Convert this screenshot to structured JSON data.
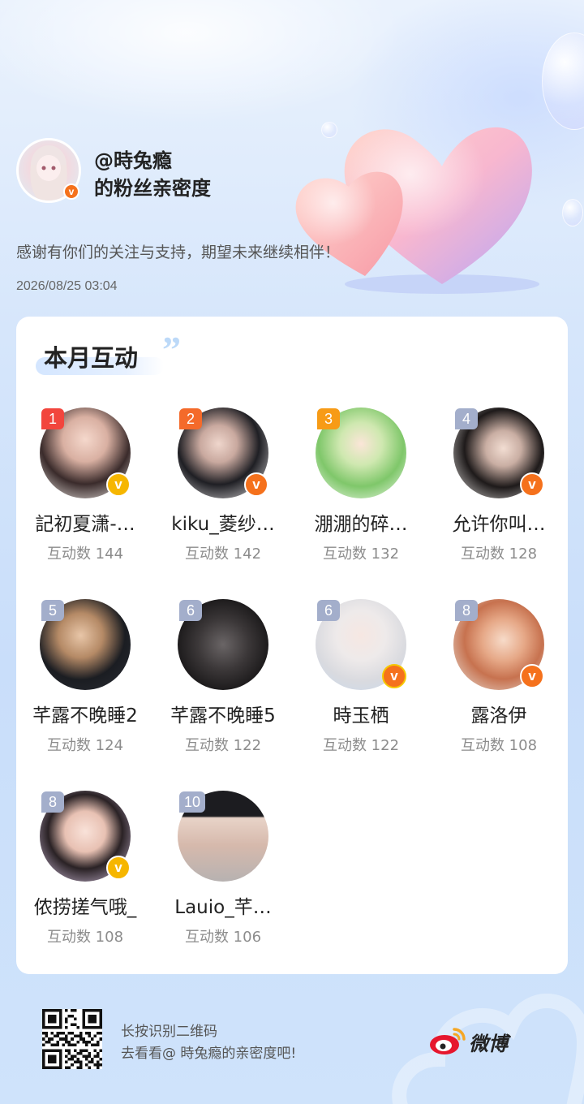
{
  "header": {
    "username": "@時兔瘾",
    "title": "的粉丝亲密度",
    "message": "感谢有你们的关注与支持，期望未来继续相伴！",
    "datetime": "2026/08/25 03:04",
    "verified": "v"
  },
  "card": {
    "title": "本月互动",
    "quote": "”",
    "fans": [
      {
        "rank": "1",
        "name": "記初夏潇-…",
        "count": "互动数 144",
        "badge": "v",
        "badge_color": "#f6b600"
      },
      {
        "rank": "2",
        "name": "kiku_菱纱…",
        "count": "互动数 142",
        "badge": "v",
        "badge_color": "#f5711c"
      },
      {
        "rank": "3",
        "name": "淜淜的碎…",
        "count": "互动数 132",
        "badge": "",
        "badge_color": ""
      },
      {
        "rank": "4",
        "name": "允许你叫…",
        "count": "互动数 128",
        "badge": "v",
        "badge_color": "#f5711c"
      },
      {
        "rank": "5",
        "name": "芊露不晚睡2",
        "count": "互动数 124",
        "badge": "",
        "badge_color": ""
      },
      {
        "rank": "6",
        "name": "芊露不晚睡5",
        "count": "互动数 122",
        "badge": "",
        "badge_color": ""
      },
      {
        "rank": "6",
        "name": "時玉栖",
        "count": "互动数 122",
        "badge": "v",
        "badge_color": "#f5711c"
      },
      {
        "rank": "8",
        "name": "露洛伊",
        "count": "互动数 108",
        "badge": "v",
        "badge_color": "#f5711c"
      },
      {
        "rank": "8",
        "name": "侬捞搓气哦_",
        "count": "互动数 108",
        "badge": "v",
        "badge_color": "#f6b600"
      },
      {
        "rank": "10",
        "name": "Lauio_芊…",
        "count": "互动数 106",
        "badge": "",
        "badge_color": ""
      }
    ]
  },
  "footer": {
    "line1": "长按识别二维码",
    "line2": "去看看@ 時兔瘾的亲密度吧!",
    "brand": "微博",
    "qr_icon": "qr-code-icon",
    "brand_icon": "weibo-logo-icon"
  },
  "colors": {
    "rank1": "#f2453d",
    "rank2": "#f46a2a",
    "rank3": "#f79b16",
    "rank_other": "#a3aecb",
    "verified_orange": "#f5711c",
    "verified_gold": "#f6b600"
  }
}
